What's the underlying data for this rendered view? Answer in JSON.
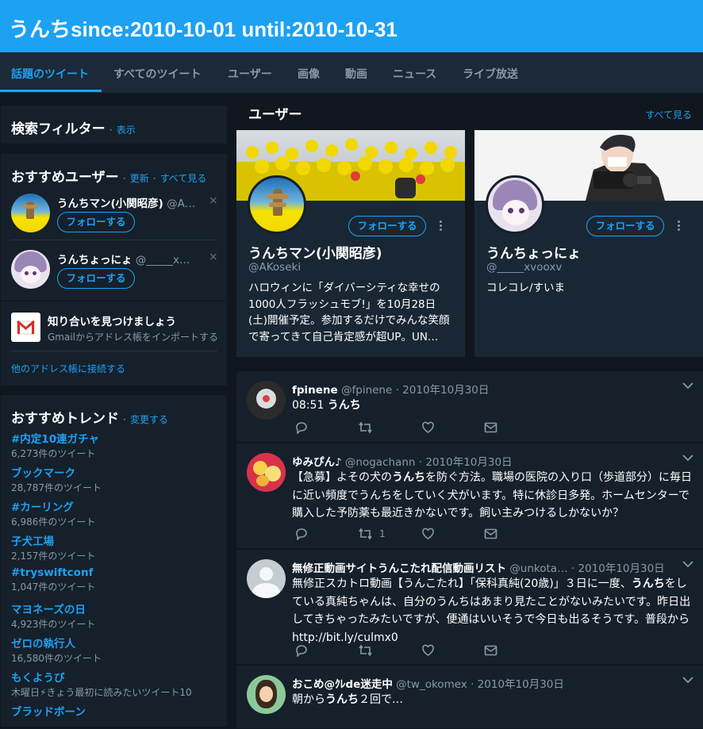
{
  "header": {
    "title": "うんちsince:2010-10-01 until:2010-10-31"
  },
  "tabs": [
    {
      "label": "話題のツイート",
      "active": true
    },
    {
      "label": "すべてのツイート"
    },
    {
      "label": "ユーザー"
    },
    {
      "label": "画像"
    },
    {
      "label": "動画"
    },
    {
      "label": "ニュース"
    },
    {
      "label": "ライブ放送"
    }
  ],
  "search_filter": {
    "title": "検索フィルター",
    "show_link": "表示",
    "sep": "·"
  },
  "who_to_follow": {
    "title": "おすすめユーザー",
    "refresh": "更新",
    "view_all": "すべて見る",
    "sep": "·",
    "users": [
      {
        "name": "うんちマン(小関昭彦)",
        "handle": "@A…",
        "follow": "フォローする",
        "close": "×"
      },
      {
        "name": "うんちょっにょ",
        "handle": "@_____x…",
        "follow": "フォローする",
        "close": "×"
      }
    ],
    "find_friends": {
      "title": "知り合いを見つけましょう",
      "subtitle": "Gmailからアドレス帳をインポートする",
      "icon": "gmail-icon"
    },
    "connect_other": "他のアドレス帳に接続する"
  },
  "trends": {
    "title": "おすすめトレンド",
    "change": "変更する",
    "sep": "·",
    "items": [
      {
        "name": "#内定10連ガチャ",
        "count": "6,273件のツイート"
      },
      {
        "name": "ブックマーク",
        "count": "28,787件のツイート"
      },
      {
        "name": "#カーリング",
        "count": "6,986件のツイート"
      },
      {
        "name": "子犬工場",
        "count": "2,157件のツイート"
      },
      {
        "name": "#tryswiftconf",
        "count": "1,047件のツイート"
      },
      {
        "name": "マヨネーズの日",
        "count": "4,923件のツイート"
      },
      {
        "name": "ゼロの執行人",
        "count": "16,580件のツイート"
      },
      {
        "name": "もくようび",
        "count": "木曜日⚡きょう最初に読みたいツイート10"
      },
      {
        "name": "ブラッドボーン",
        "count": ""
      }
    ]
  },
  "users_section": {
    "title": "ユーザー",
    "view_all": "すべて見る",
    "cards": [
      {
        "name": "うんちマン(小関昭彦)",
        "handle": "@AKoseki",
        "follow": "フォローする",
        "bio": "ハロウィンに「ダイバーシティな幸せの1000人フラッシュモブ!」を10月28日(土)開催予定。参加するだけでみんな笑顔で寄ってきて自己肯定感が超UP。UN…"
      },
      {
        "name": "うんちょっにょ",
        "handle": "@_____xvooxv",
        "follow": "フォローする",
        "bio": "コレコレ/すいま"
      }
    ]
  },
  "tweets": [
    {
      "name": "fpinene",
      "handle": "@fpinene",
      "date": "· 2010年10月30日",
      "body_pre": "08:51 ",
      "body_bold": "うんち",
      "body_post": "",
      "retweets": "",
      "avatar_color": "#cfd6dc"
    },
    {
      "name": "ゆみぴん♪",
      "handle": "@nogachann",
      "date": "· 2010年10月30日",
      "body_pre": "【急募】よその犬の",
      "body_bold": "うんち",
      "body_post": "を防ぐ方法。職場の医院の入り口（歩道部分）に毎日に近い頻度でうんちをしていく犬がいます。特に休診日多発。ホームセンターで購入した予防薬も最近きかないです。飼い主みつけるしかないか？",
      "retweets": "1",
      "avatar_color": "#e0334a"
    },
    {
      "name": "無修正動画サイトうんこたれ配信動画リスト",
      "handle": "@unkota…",
      "date": "· 2010年10月30日",
      "body_pre": "無修正スカトロ動画【うんこたれ】「保科真純(20歳)」３日に一度、",
      "body_bold": "うんち",
      "body_post": "をしている真純ちゃんは、自分のうんちはあまり見たことがないみたいです。昨日出してきちゃったみたいですが、便通はいいそうで今日も出るそうです。普段から http://bit.ly/culmx0",
      "retweets": "",
      "avatar_color": "#c0c7cc"
    },
    {
      "name": "おこめ@ｸﾚde迷走中",
      "handle": "@tw_okomex",
      "date": "· 2010年10月30日",
      "body_pre": "朝から",
      "body_bold": "うんち",
      "body_post": "２回で…",
      "retweets": "",
      "avatar_color": "#7cc38a"
    }
  ],
  "colors": {
    "accent": "#1da1f2",
    "background": "#10171e",
    "panel": "#15202b",
    "muted": "#8899a6"
  }
}
